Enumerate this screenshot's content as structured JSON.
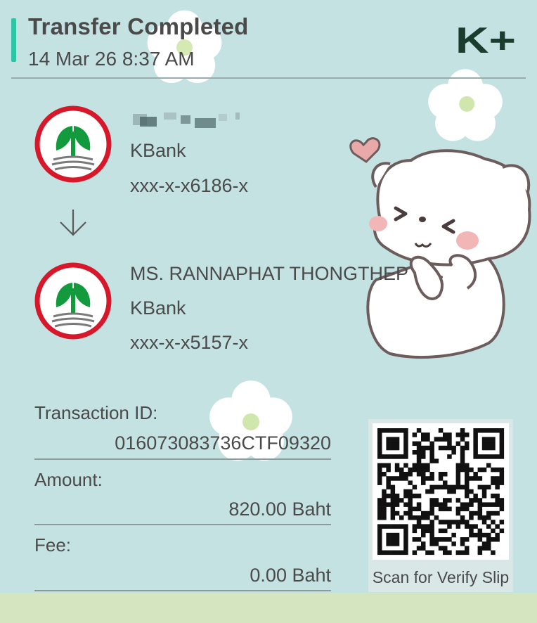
{
  "header": {
    "title": "Transfer Completed",
    "datetime": "14 Mar 26  8:37 AM",
    "logo_text": "K+"
  },
  "sender": {
    "name_hidden": true,
    "bank": "KBank",
    "account": "xxx-x-x6186-x"
  },
  "recipient": {
    "name": "MS. RANNAPHAT THONGTHEP",
    "bank": "KBank",
    "account": "xxx-x-x5157-x"
  },
  "details": {
    "transaction_id_label": "Transaction ID:",
    "transaction_id": "016073083736CTF09320",
    "amount_label": "Amount:",
    "amount": "820.00 Baht",
    "fee_label": "Fee:",
    "fee": "0.00 Baht"
  },
  "qr": {
    "caption": "Scan for Verify Slip"
  },
  "colors": {
    "background": "#c5e2e2",
    "accent": "#2ec4a6",
    "kbank_green": "#139a3c",
    "kbank_red": "#d7182a",
    "text": "#4a4a4a",
    "bottom_strip": "#d5e5c0"
  },
  "icons": [
    "kbank-logo-icon",
    "down-arrow-icon",
    "k-plus-logo-icon",
    "qr-code-icon"
  ]
}
